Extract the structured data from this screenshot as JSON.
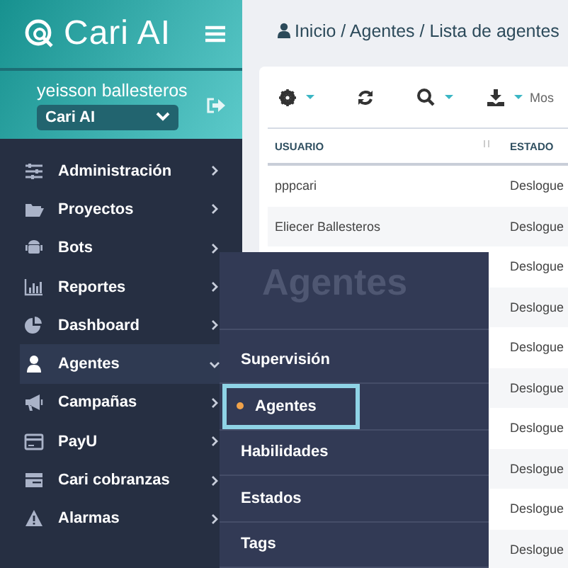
{
  "brand": {
    "name": "Cari AI"
  },
  "user": {
    "name": "yeisson ballesteros",
    "account": "Cari AI"
  },
  "nav": [
    {
      "label": "Administración",
      "expanded": false,
      "selected": false
    },
    {
      "label": "Proyectos",
      "expanded": false,
      "selected": false
    },
    {
      "label": "Bots",
      "expanded": false,
      "selected": false
    },
    {
      "label": "Reportes",
      "expanded": false,
      "selected": false
    },
    {
      "label": "Dashboard",
      "expanded": false,
      "selected": false
    },
    {
      "label": "Agentes",
      "expanded": true,
      "selected": true
    },
    {
      "label": "Campañas",
      "expanded": false,
      "selected": false
    },
    {
      "label": "PayU",
      "expanded": false,
      "selected": false
    },
    {
      "label": "Cari cobranzas",
      "expanded": false,
      "selected": false
    },
    {
      "label": "Alarmas",
      "expanded": false,
      "selected": false
    }
  ],
  "breadcrumb": "Inicio / Agentes / Lista de agentes",
  "toolbar": {
    "show_label": "Mos"
  },
  "table": {
    "columns": [
      "USUARIO",
      "ESTADO"
    ],
    "rows": [
      {
        "usuario": "pppcari",
        "estado": "Deslogue"
      },
      {
        "usuario": "Eliecer Ballesteros",
        "estado": "Deslogue"
      },
      {
        "estado": "Deslogue"
      },
      {
        "estado": "Deslogue"
      },
      {
        "estado": "Deslogue"
      },
      {
        "estado": "Deslogue"
      },
      {
        "estado": "Deslogue"
      },
      {
        "estado": "Deslogue"
      },
      {
        "estado": "Deslogue"
      },
      {
        "estado": "Deslogue"
      }
    ]
  },
  "flyout": {
    "title": "Agentes",
    "items": [
      {
        "label": "Supervisión",
        "selected": false
      },
      {
        "label": "Agentes",
        "selected": true
      },
      {
        "label": "Habilidades",
        "selected": false
      },
      {
        "label": "Estados",
        "selected": false
      },
      {
        "label": "Tags",
        "selected": false
      }
    ]
  }
}
